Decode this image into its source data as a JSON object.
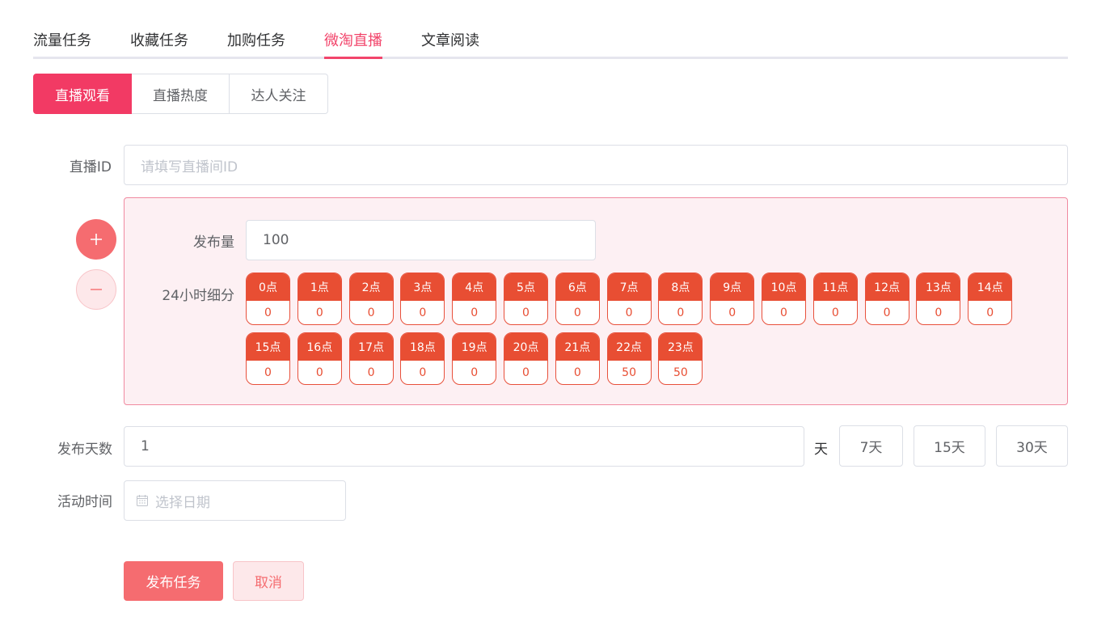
{
  "tabs": [
    {
      "label": "流量任务",
      "active": false
    },
    {
      "label": "收藏任务",
      "active": false
    },
    {
      "label": "加购任务",
      "active": false
    },
    {
      "label": "微淘直播",
      "active": true
    },
    {
      "label": "文章阅读",
      "active": false
    }
  ],
  "sub_tabs": [
    {
      "label": "直播观看",
      "active": true
    },
    {
      "label": "直播热度",
      "active": false
    },
    {
      "label": "达人关注",
      "active": false
    }
  ],
  "form": {
    "live_id_label": "直播ID",
    "live_id_placeholder": "请填写直播间ID",
    "publish_amount_label": "发布量",
    "publish_amount_value": "100",
    "breakdown_label": "24小时细分",
    "hours": [
      {
        "label": "0点",
        "value": "0"
      },
      {
        "label": "1点",
        "value": "0"
      },
      {
        "label": "2点",
        "value": "0"
      },
      {
        "label": "3点",
        "value": "0"
      },
      {
        "label": "4点",
        "value": "0"
      },
      {
        "label": "5点",
        "value": "0"
      },
      {
        "label": "6点",
        "value": "0"
      },
      {
        "label": "7点",
        "value": "0"
      },
      {
        "label": "8点",
        "value": "0"
      },
      {
        "label": "9点",
        "value": "0"
      },
      {
        "label": "10点",
        "value": "0"
      },
      {
        "label": "11点",
        "value": "0"
      },
      {
        "label": "12点",
        "value": "0"
      },
      {
        "label": "13点",
        "value": "0"
      },
      {
        "label": "14点",
        "value": "0"
      },
      {
        "label": "15点",
        "value": "0"
      },
      {
        "label": "16点",
        "value": "0"
      },
      {
        "label": "17点",
        "value": "0"
      },
      {
        "label": "18点",
        "value": "0"
      },
      {
        "label": "19点",
        "value": "0"
      },
      {
        "label": "20点",
        "value": "0"
      },
      {
        "label": "21点",
        "value": "0"
      },
      {
        "label": "22点",
        "value": "50"
      },
      {
        "label": "23点",
        "value": "50"
      }
    ],
    "days_label": "发布天数",
    "days_value": "1",
    "days_unit": "天",
    "day_presets": [
      "7天",
      "15天",
      "30天"
    ],
    "activity_time_label": "活动时间",
    "date_placeholder": "选择日期"
  },
  "actions": {
    "submit_label": "发布任务",
    "cancel_label": "取消"
  },
  "icons": {
    "add": "plus-icon",
    "remove": "minus-icon",
    "date": "calendar-icon"
  },
  "colors": {
    "accent": "#f2456b",
    "hour_red": "#e84e33",
    "button_red": "#f56c70",
    "panel_bg": "#fdf0f3"
  }
}
